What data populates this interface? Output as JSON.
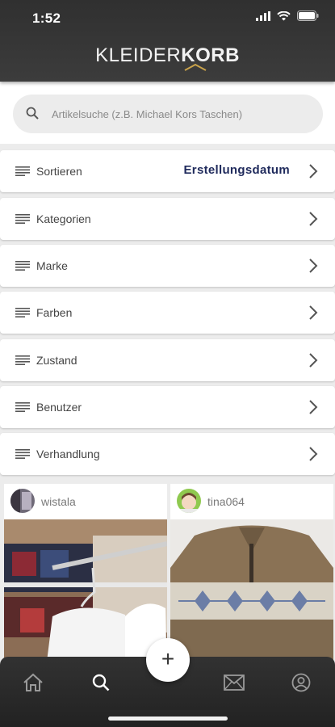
{
  "status_bar": {
    "time": "1:52"
  },
  "header": {
    "logo_light": "KLEIDER",
    "logo_bold": "KORB"
  },
  "search": {
    "placeholder": "Artikelsuche (z.B. Michael Kors Taschen)",
    "value": ""
  },
  "filters": [
    {
      "label": "Sortieren",
      "value": "Erstellungsdatum"
    },
    {
      "label": "Kategorien",
      "value": ""
    },
    {
      "label": "Marke",
      "value": ""
    },
    {
      "label": "Farben",
      "value": ""
    },
    {
      "label": "Zustand",
      "value": ""
    },
    {
      "label": "Benutzer",
      "value": ""
    },
    {
      "label": "Verhandlung",
      "value": ""
    }
  ],
  "products": [
    {
      "username": "wistala"
    },
    {
      "username": "tina064"
    }
  ],
  "nav": {
    "items": [
      "home-icon",
      "search-icon",
      "add-button",
      "mail-icon",
      "profile-icon"
    ],
    "fab_label": "+"
  },
  "colors": {
    "header": "#333333",
    "accent_text": "#1f2a5c",
    "logo_gold": "#c9a24a"
  }
}
